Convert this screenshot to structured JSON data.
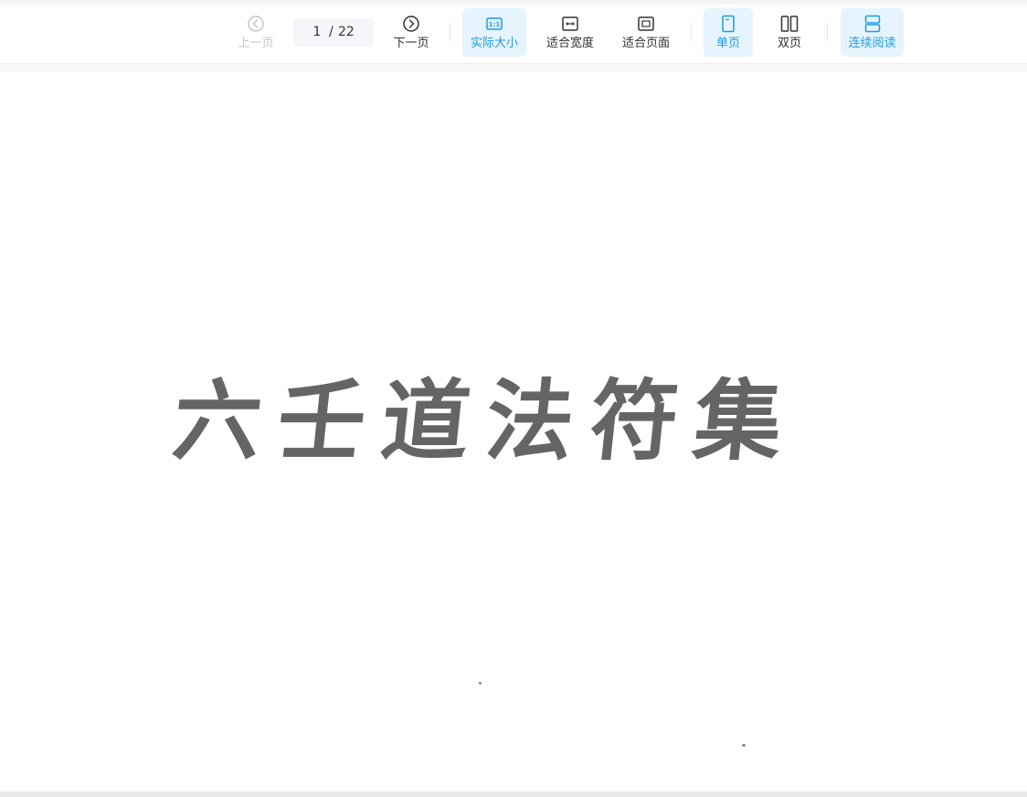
{
  "toolbar": {
    "prev_label": "上一页",
    "next_label": "下一页",
    "page_current": "1",
    "page_separator": "/",
    "page_total": "22",
    "actual_size_label": "实际大小",
    "fit_width_label": "适合宽度",
    "fit_page_label": "适合页面",
    "single_page_label": "单页",
    "double_page_label": "双页",
    "continuous_label": "连续阅读"
  },
  "document": {
    "title_text": "六壬道法符集"
  },
  "colors": {
    "accent": "#1d9be6",
    "active_bg": "#e6f4fd",
    "disabled": "#c3c6cc"
  },
  "icons": {
    "prev": "circle-chevron-left-icon",
    "next": "circle-chevron-right-icon",
    "actual_size": "one-to-one-icon",
    "fit_width": "fit-width-icon",
    "fit_page": "fit-page-icon",
    "single_page": "single-page-icon",
    "double_page": "double-page-icon",
    "continuous": "continuous-read-icon"
  }
}
